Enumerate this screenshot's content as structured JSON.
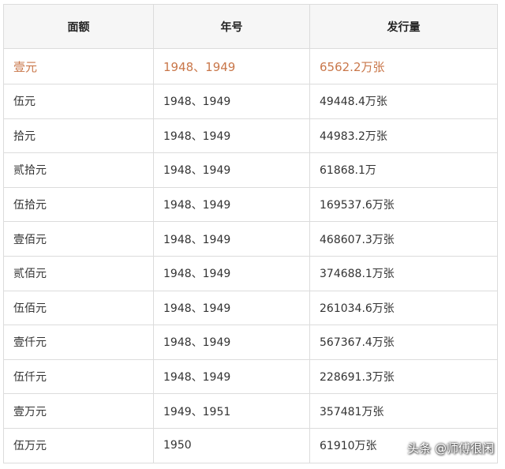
{
  "table": {
    "headers": [
      "面额",
      "年号",
      "发行量"
    ],
    "rows": [
      [
        "壹元",
        "1948、1949",
        "6562.2万张"
      ],
      [
        "伍元",
        "1948、1949",
        "49448.4万张"
      ],
      [
        "拾元",
        "1948、1949",
        "44983.2万张"
      ],
      [
        "贰拾元",
        "1948、1949",
        "61868.1万"
      ],
      [
        "伍拾元",
        "1948、1949",
        "169537.6万张"
      ],
      [
        "壹佰元",
        "1948、1949",
        "468607.3万张"
      ],
      [
        "贰佰元",
        "1948、1949",
        "374688.1万张"
      ],
      [
        "伍佰元",
        "1948、1949",
        "261034.6万张"
      ],
      [
        "壹仟元",
        "1948、1949",
        "567367.4万张"
      ],
      [
        "伍仟元",
        "1948、1949",
        "228691.3万张"
      ],
      [
        "壹万元",
        "1949、1951",
        "357481万张"
      ],
      [
        "伍万元",
        "1950",
        "61910万张"
      ]
    ],
    "highlight_color": "#c9774a"
  },
  "watermark": {
    "text": "头条 @师傅很闲"
  }
}
